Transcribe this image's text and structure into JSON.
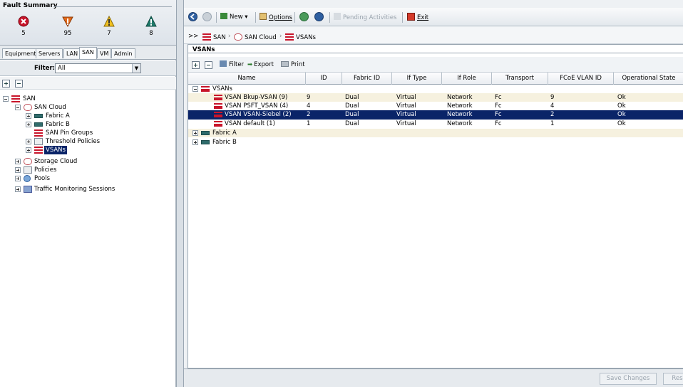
{
  "fault_summary": {
    "title": "Fault Summary",
    "items": [
      {
        "kind": "critical",
        "icon": "critical-x-icon",
        "count": "5"
      },
      {
        "kind": "major",
        "icon": "major-triangle-icon",
        "count": "95"
      },
      {
        "kind": "minor",
        "icon": "minor-warning-icon",
        "count": "7"
      },
      {
        "kind": "warning",
        "icon": "warning-triangle-icon",
        "count": "8"
      }
    ]
  },
  "nav_tabs": [
    "Equipment",
    "Servers",
    "LAN",
    "SAN",
    "VM",
    "Admin"
  ],
  "active_tab": "SAN",
  "filter": {
    "label": "Filter:",
    "value": "All"
  },
  "tree": {
    "root": "SAN",
    "san_cloud": "SAN Cloud",
    "fabric_a": "Fabric A",
    "fabric_b": "Fabric B",
    "san_pin_groups": "SAN Pin Groups",
    "threshold_policies": "Threshold Policies",
    "vsans": "VSANs",
    "storage_cloud": "Storage Cloud",
    "policies": "Policies",
    "pools": "Pools",
    "traffic_monitoring": "Traffic Monitoring Sessions"
  },
  "toolbar": {
    "new": "New",
    "options": "Options",
    "pending": "Pending Activities",
    "exit": "Exit"
  },
  "breadcrumb": {
    "prefix": ">>",
    "items": [
      "SAN",
      "SAN Cloud",
      "VSANs"
    ],
    "separator": "›"
  },
  "panel_title": "VSANs",
  "grid_toolbar": {
    "filter": "Filter",
    "export": "Export",
    "print": "Print"
  },
  "table": {
    "columns": [
      "Name",
      "ID",
      "Fabric ID",
      "If Type",
      "If Role",
      "Transport",
      "FCoE VLAN ID",
      "Operational State"
    ],
    "group_label": "VSANs",
    "rows": [
      {
        "name": "VSAN Bkup-VSAN (9)",
        "id": "9",
        "fabric": "Dual",
        "if_type": "Virtual",
        "if_role": "Network",
        "transport": "Fc",
        "fcoe": "9",
        "state": "Ok"
      },
      {
        "name": "VSAN PSFT_VSAN (4)",
        "id": "4",
        "fabric": "Dual",
        "if_type": "Virtual",
        "if_role": "Network",
        "transport": "Fc",
        "fcoe": "4",
        "state": "Ok"
      },
      {
        "name": "VSAN VSAN-Siebel (2)",
        "id": "2",
        "fabric": "Dual",
        "if_type": "Virtual",
        "if_role": "Network",
        "transport": "Fc",
        "fcoe": "2",
        "state": "Ok"
      },
      {
        "name": "VSAN default (1)",
        "id": "1",
        "fabric": "Dual",
        "if_type": "Virtual",
        "if_role": "Network",
        "transport": "Fc",
        "fcoe": "1",
        "state": "Ok"
      }
    ],
    "selected_row": 2,
    "fabric_a": "Fabric A",
    "fabric_b": "Fabric B"
  },
  "footer": {
    "save": "Save Changes",
    "reset": "Res"
  },
  "colors": {
    "selection": "#0a2468",
    "critical": "#c8142a",
    "major": "#e36a1a",
    "minor": "#f0c020",
    "warning": "#1f7a6a"
  }
}
